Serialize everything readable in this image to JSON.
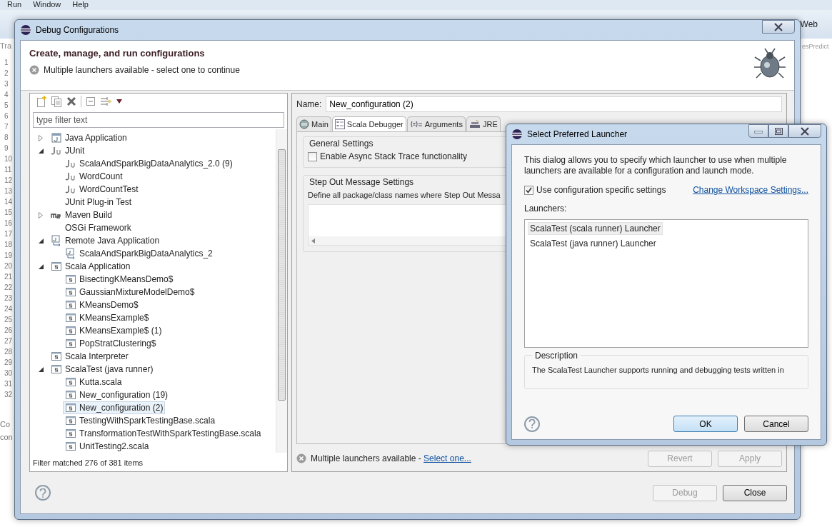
{
  "ide": {
    "menu": [
      "Run",
      "Window",
      "Help"
    ],
    "toolbar_fragment": "Web",
    "editor_tab": "Tra",
    "editor_tab_right": "esPredict",
    "line_numbers": [
      "1",
      "2",
      "3",
      "4",
      "5",
      "6",
      "7",
      "8",
      "9",
      "10",
      "11",
      "12",
      "13",
      "14",
      "15",
      "16",
      "17",
      "18",
      "19",
      "20",
      "21",
      "22",
      "23",
      "24",
      "25",
      "26",
      "27",
      "28",
      "29",
      "30",
      "31",
      "32"
    ],
    "bottom_fragments": [
      "Co",
      "con"
    ]
  },
  "debug_window": {
    "title": "Debug Configurations",
    "header_title": "Create, manage, and run configurations",
    "header_message": "Multiple launchers available - select one to continue",
    "filter": {
      "placeholder": "type filter text"
    },
    "tree": [
      {
        "label": "Java Application",
        "kind": "java",
        "expanded": false,
        "selected": false
      },
      {
        "label": "JUnit",
        "kind": "junit",
        "expanded": true,
        "selected": false,
        "children": [
          {
            "label": "ScalaAndSparkBigDataAnalytics_2.0 (9)",
            "kind": "junit",
            "selected": false
          },
          {
            "label": "WordCount",
            "kind": "junit",
            "selected": false
          },
          {
            "label": "WordCountTest",
            "kind": "junit",
            "selected": false
          }
        ]
      },
      {
        "label": "JUnit Plug-in Test",
        "kind": "plain",
        "selected": false
      },
      {
        "label": "Maven Build",
        "kind": "maven",
        "expanded": false,
        "selected": false
      },
      {
        "label": "OSGi Framework",
        "kind": "plain",
        "selected": false
      },
      {
        "label": "Remote Java Application",
        "kind": "remote",
        "expanded": true,
        "selected": false,
        "children": [
          {
            "label": "ScalaAndSparkBigDataAnalytics_2",
            "kind": "remote",
            "selected": false
          }
        ]
      },
      {
        "label": "Scala Application",
        "kind": "scala",
        "expanded": true,
        "selected": false,
        "children": [
          {
            "label": "BisectingKMeansDemo$",
            "kind": "scala",
            "selected": false
          },
          {
            "label": "GaussianMixtureModelDemo$",
            "kind": "scala",
            "selected": false
          },
          {
            "label": "KMeansDemo$",
            "kind": "scala",
            "selected": false
          },
          {
            "label": "KMeansExample$",
            "kind": "scala",
            "selected": false
          },
          {
            "label": "KMeansExample$ (1)",
            "kind": "scala",
            "selected": false
          },
          {
            "label": "PopStratClustering$",
            "kind": "scala",
            "selected": false
          }
        ]
      },
      {
        "label": "Scala Interpreter",
        "kind": "scala",
        "selected": false
      },
      {
        "label": "ScalaTest (java runner)",
        "kind": "scala",
        "expanded": true,
        "selected": false,
        "children": [
          {
            "label": "Kutta.scala",
            "kind": "scala",
            "selected": false
          },
          {
            "label": "New_configuration (19)",
            "kind": "scala",
            "selected": false
          },
          {
            "label": "New_configuration (2)",
            "kind": "scala",
            "selected": true
          },
          {
            "label": "TestingWithSparkTestingBase.scala",
            "kind": "scala",
            "selected": false
          },
          {
            "label": "TransformationTestWithSparkTestingBase.scala",
            "kind": "scala",
            "selected": false
          },
          {
            "label": "UnitTesting2.scala",
            "kind": "scala",
            "selected": false
          }
        ]
      }
    ],
    "filter_status": "Filter matched 276 of 381 items",
    "name_label": "Name:",
    "name_value": "New_configuration (2)",
    "tabs": [
      {
        "label": "Main",
        "kind": "main",
        "selected": false
      },
      {
        "label": "Scala Debugger",
        "kind": "debugger",
        "selected": true
      },
      {
        "label": "Arguments",
        "kind": "arguments",
        "selected": false
      },
      {
        "label": "JRE",
        "kind": "jre",
        "selected": false
      }
    ],
    "general_settings": {
      "title": "General Settings",
      "checkbox": {
        "label": "Enable Async Stack Trace functionality",
        "checked": false
      }
    },
    "step_out": {
      "title": "Step Out Message Settings",
      "description": "Define all package/class names where Step Out Messa"
    },
    "status": {
      "message": "Multiple launchers available -",
      "link": "Select one..."
    },
    "panel_buttons": [
      {
        "label": "Revert",
        "disabled": true
      },
      {
        "label": "Apply",
        "disabled": true
      }
    ],
    "buttons": [
      {
        "label": "Debug",
        "disabled": true
      },
      {
        "label": "Close",
        "disabled": false
      }
    ]
  },
  "launcher_dialog": {
    "title": "Select Preferred Launcher",
    "intro": "This dialog allows you to specify which launcher to use when multiple launchers are available for a configuration and launch mode.",
    "use_specific": {
      "label": "Use configuration specific settings",
      "checked": true
    },
    "workspace_link": "Change Workspace Settings...",
    "launchers_label": "Launchers:",
    "launchers": [
      {
        "label": "ScalaTest (scala runner) Launcher",
        "selected": true
      },
      {
        "label": "ScalaTest (java runner) Launcher",
        "selected": false
      }
    ],
    "description_title": "Description",
    "description": "The ScalaTest Launcher supports running and debugging tests written in",
    "buttons": [
      {
        "label": "OK",
        "default": true
      },
      {
        "label": "Cancel",
        "default": false
      }
    ]
  }
}
